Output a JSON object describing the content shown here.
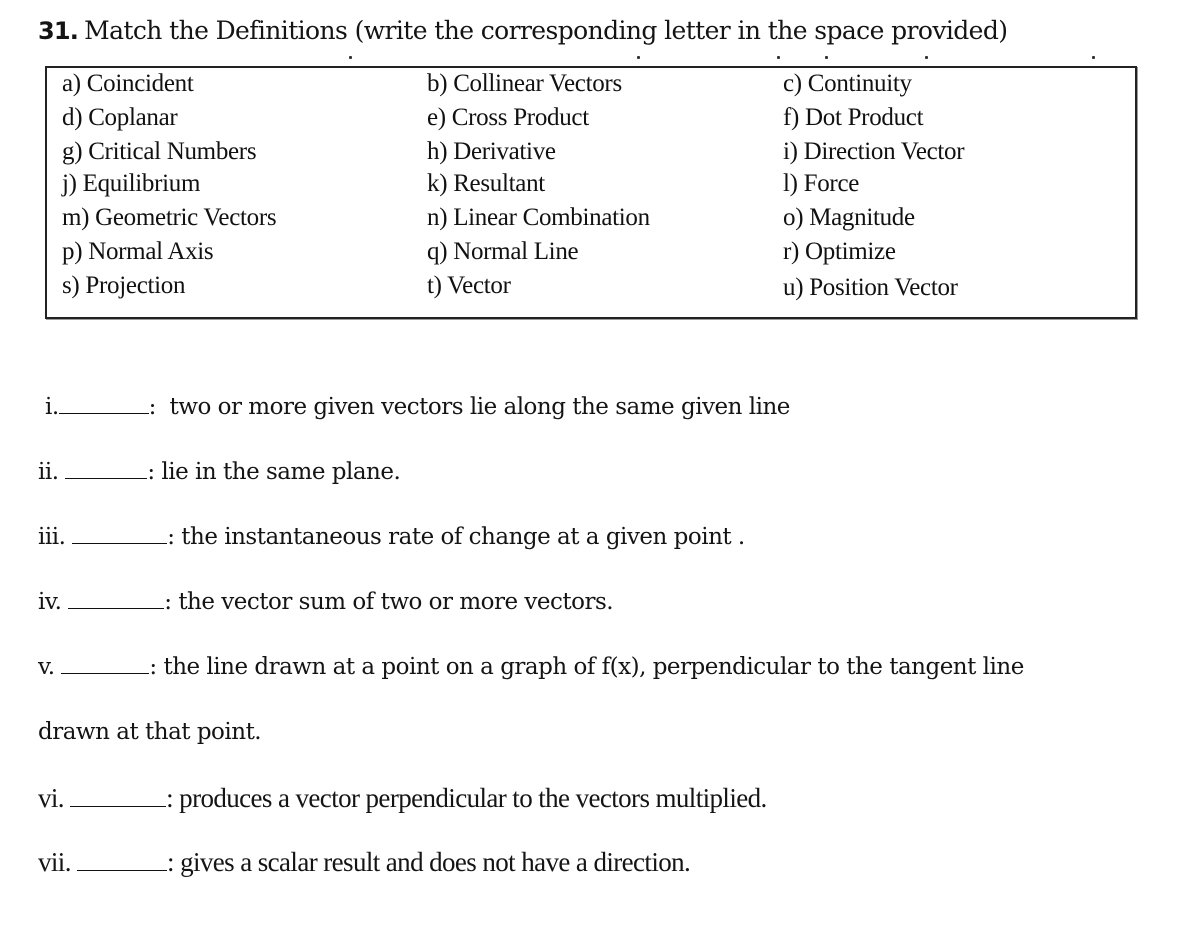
{
  "document": {
    "question_number": "31.",
    "title": "Match the Definitions (write the corresponding letter in the space provided)"
  },
  "terms": [
    {
      "letter": "a)",
      "term": "Coincident"
    },
    {
      "letter": "b)",
      "term": "Collinear Vectors"
    },
    {
      "letter": "c)",
      "term": "Continuity"
    },
    {
      "letter": "d)",
      "term": "Coplanar"
    },
    {
      "letter": "e)",
      "term": "Cross Product"
    },
    {
      "letter": "f)",
      "term": "Dot Product"
    },
    {
      "letter": "g)",
      "term": "Critical Numbers"
    },
    {
      "letter": "h)",
      "term": "Derivative"
    },
    {
      "letter": "i)",
      "term": "Direction Vector"
    },
    {
      "letter": "j)",
      "term": "Equilibrium"
    },
    {
      "letter": "k)",
      "term": "Resultant"
    },
    {
      "letter": "l)",
      "term": "Force"
    },
    {
      "letter": "m)",
      "term": "Geometric Vectors"
    },
    {
      "letter": "n)",
      "term": "Linear Combination"
    },
    {
      "letter": "o)",
      "term": "Magnitude"
    },
    {
      "letter": "p)",
      "term": "Normal Axis"
    },
    {
      "letter": "q)",
      "term": "Normal Line"
    },
    {
      "letter": "r)",
      "term": "Optimize"
    },
    {
      "letter": "s)",
      "term": "Projection"
    },
    {
      "letter": "t)",
      "term": "Vector"
    },
    {
      "letter": "u)",
      "term": "Position Vector"
    }
  ],
  "questions": [
    {
      "numeral": "i.",
      "answer": "",
      "definition": "two or more given vectors lie along the same given line"
    },
    {
      "numeral": "ii.",
      "answer": "",
      "definition": "lie in the same plane."
    },
    {
      "numeral": "iii.",
      "answer": "",
      "definition": "the instantaneous rate of change at a given point ."
    },
    {
      "numeral": "iv.",
      "answer": "",
      "definition": "the vector sum of two or more vectors."
    },
    {
      "numeral": "v.",
      "answer": "",
      "definition": "the line drawn at a point on a graph of f(x), perpendicular to the tangent line",
      "continuation": "drawn at that point."
    },
    {
      "numeral": "vi.",
      "answer": "",
      "definition": "produces a vector perpendicular to the vectors multiplied."
    },
    {
      "numeral": "vii.",
      "answer": "",
      "definition": "gives a scalar result and does not have a direction."
    }
  ]
}
